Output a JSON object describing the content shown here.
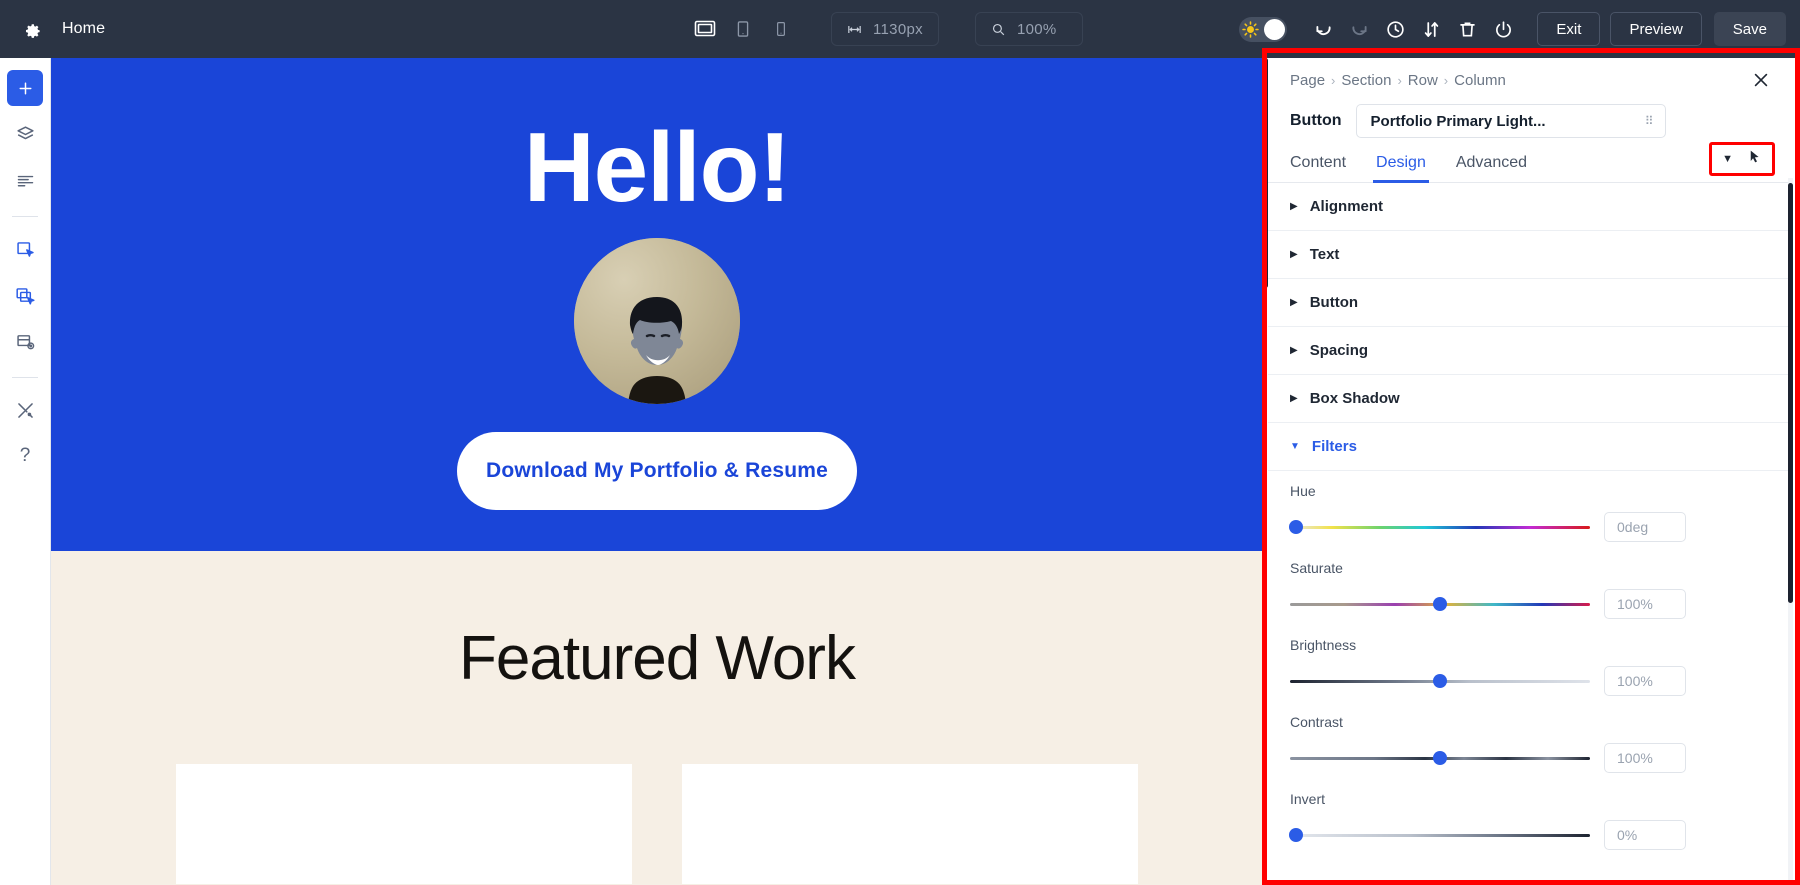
{
  "topbar": {
    "gear_icon": "gear-icon",
    "home_label": "Home",
    "devices": [
      {
        "name": "desktop",
        "icon": "desktop-icon",
        "active": true
      },
      {
        "name": "tablet",
        "icon": "tablet-icon",
        "active": false
      },
      {
        "name": "mobile",
        "icon": "mobile-icon",
        "active": false
      }
    ],
    "width_value": "1130px",
    "width_icon": "arrows-horizontal-icon",
    "zoom_value": "100%",
    "zoom_icon": "magnifier-icon",
    "theme_toggle": {
      "icon": "sun-icon",
      "state": "light"
    },
    "actions": [
      {
        "name": "undo",
        "icon": "undo-icon"
      },
      {
        "name": "redo",
        "icon": "redo-icon"
      },
      {
        "name": "history",
        "icon": "clock-icon"
      },
      {
        "name": "sort",
        "icon": "sort-arrows-icon"
      },
      {
        "name": "trash",
        "icon": "trash-icon"
      },
      {
        "name": "power",
        "icon": "power-icon"
      }
    ],
    "exit_label": "Exit",
    "preview_label": "Preview",
    "save_label": "Save"
  },
  "sidebar": {
    "items": [
      {
        "name": "add",
        "icon": "plus-icon",
        "label": "Add"
      },
      {
        "name": "layers",
        "icon": "layers-icon",
        "label": "Layers"
      },
      {
        "name": "list",
        "icon": "list-icon",
        "label": "Structure"
      },
      {
        "name": "select-element",
        "icon": "select-element-icon",
        "label": "Select Element"
      },
      {
        "name": "copy-element",
        "icon": "copy-element-icon",
        "label": "Copy Element"
      },
      {
        "name": "media",
        "icon": "media-block-icon",
        "label": "Media"
      },
      {
        "name": "tools",
        "icon": "wrench-screwdriver-icon",
        "label": "Tools"
      },
      {
        "name": "help",
        "icon": "question-mark-icon",
        "label": "Help"
      }
    ]
  },
  "canvas": {
    "hero": {
      "title": "Hello!",
      "avatar_alt": "portrait-avatar",
      "cta_label": "Download My Portfolio & Resume",
      "bg_color": "#1a45d8",
      "cta_bg": "#ffffff",
      "cta_text_color": "#1a45d8"
    },
    "featured": {
      "title": "Featured Work",
      "bg_color": "#f6efe5",
      "cards": [
        {
          "name": "card-1"
        },
        {
          "name": "card-2"
        }
      ]
    }
  },
  "panel": {
    "breadcrumb": [
      "Page",
      "Section",
      "Row",
      "Column"
    ],
    "breadcrumb_sep": "›",
    "close_icon": "close-icon",
    "element_type": "Button",
    "element_name": "Portfolio Primary Light...",
    "element_grip_icon": "grip-dots-icon",
    "tabs": [
      {
        "label": "Content",
        "active": false
      },
      {
        "label": "Design",
        "active": true
      },
      {
        "label": "Advanced",
        "active": false
      }
    ],
    "tab_extra": {
      "caret_icon": "chevron-down-icon",
      "pointer_icon": "cursor-arrow-icon",
      "highlight_color": "#ff0000"
    },
    "accordions": [
      {
        "title": "Alignment",
        "open": false,
        "tri": "▶"
      },
      {
        "title": "Text",
        "open": false,
        "tri": "▶"
      },
      {
        "title": "Button",
        "open": false,
        "tri": "▶"
      },
      {
        "title": "Spacing",
        "open": false,
        "tri": "▶"
      },
      {
        "title": "Box Shadow",
        "open": false,
        "tri": "▶"
      },
      {
        "title": "Filters",
        "open": true,
        "tri": "▼"
      }
    ],
    "filters": [
      {
        "label": "Hue",
        "value": "0deg",
        "pos": 2,
        "track": "hue"
      },
      {
        "label": "Saturate",
        "value": "100%",
        "pos": 50,
        "track": "saturate"
      },
      {
        "label": "Brightness",
        "value": "100%",
        "pos": 50,
        "track": "brightness"
      },
      {
        "label": "Contrast",
        "value": "100%",
        "pos": 50,
        "track": "contrast"
      },
      {
        "label": "Invert",
        "value": "0%",
        "pos": 2,
        "track": "invert"
      }
    ]
  }
}
